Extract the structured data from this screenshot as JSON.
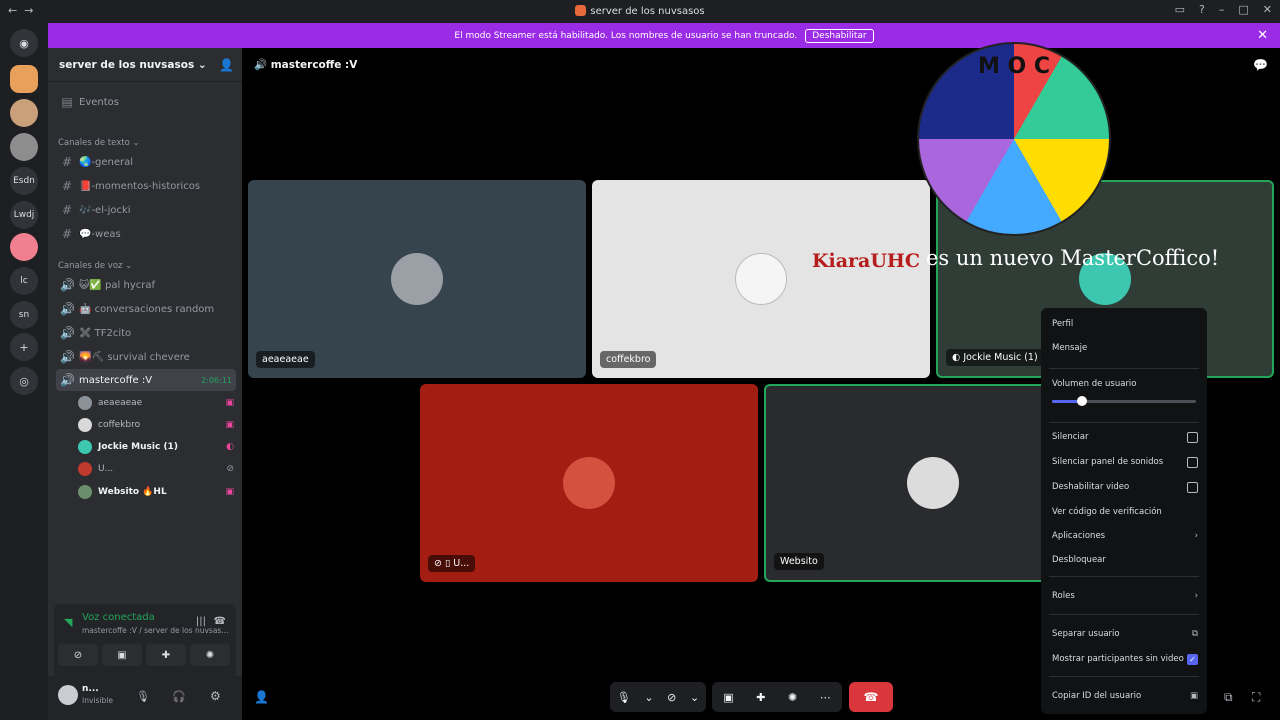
{
  "window": {
    "title": "server de los nuvsasos",
    "nav_back": "←",
    "nav_fwd": "→"
  },
  "banner": {
    "text": "El modo Streamer está habilitado. Los nombres de usuario se han truncado.",
    "button": "Deshabilitar",
    "close": "✕"
  },
  "guilds": [
    {
      "label": "Esdn"
    },
    {
      "label": "Lwdj"
    },
    {
      "label": "lc"
    },
    {
      "label": "sn"
    }
  ],
  "sidebar": {
    "server_name": "server de los nuvsasos",
    "events": "Eventos",
    "text_category": "Canales de texto",
    "text_channels": [
      "🌏-general",
      "📕-momentos-historicos",
      "🎶-el-jocki",
      "💬-weas"
    ],
    "voice_category": "Canales de voz",
    "voice_channels": [
      "😺✅ pal hycraf",
      "🤖 conversaciones random",
      "✖️ TF2cito",
      "🌄⛏ survival chevere"
    ],
    "active_voice": {
      "name": "mastercoffe :V",
      "timer": "2:06:11"
    },
    "members": [
      {
        "name": "aeaeaeae",
        "bold": false
      },
      {
        "name": "coffekbro",
        "bold": false
      },
      {
        "name": "Jockie Music (1)",
        "bold": true
      },
      {
        "name": "U...",
        "bold": false
      },
      {
        "name": "Websito 🔥HL",
        "bold": true
      }
    ]
  },
  "voice_panel": {
    "title": "Voz conectada",
    "subtitle": "mastercoffe :V / server de los nuvsas..."
  },
  "user": {
    "name": "n...",
    "status": "Invisible"
  },
  "stage": {
    "channel_title": "mastercoffe :V",
    "tiles": [
      {
        "label": "aeaeaeae"
      },
      {
        "label": "coffekbro"
      },
      {
        "label": "Jockie Music (1)"
      },
      {
        "label": "U..."
      },
      {
        "label": "Websito"
      }
    ],
    "overlay_text": "es un nuevo MasterCoffico!",
    "overlay_brand": "KiaraUHC",
    "wheel_letters": "M O C"
  },
  "context_menu": {
    "items": [
      {
        "label": "Perfil"
      },
      {
        "label": "Mensaje"
      },
      {
        "label": "Volumen de usuario"
      },
      {
        "label": "Silenciar"
      },
      {
        "label": "Silenciar panel de sonidos"
      },
      {
        "label": "Deshabilitar video"
      },
      {
        "label": "Ver código de verificación"
      },
      {
        "label": "Aplicaciones"
      },
      {
        "label": "Desbloquear"
      },
      {
        "label": "Roles"
      },
      {
        "label": "Separar usuario"
      },
      {
        "label": "Mostrar participantes sin video"
      },
      {
        "label": "Copiar ID del usuario"
      }
    ],
    "volume_fraction": 0.21,
    "show_no_video_checked": true
  },
  "colors": {
    "banner": "#9b2ce6",
    "tile1": "#36444d",
    "tile2": "#e4e4e4",
    "tile3": "#2f3d36",
    "tile4": "#a31d12",
    "tile5": "#2a2b2e",
    "accent": "#5865f2",
    "hangup": "#da373c",
    "connected": "#23a55a"
  }
}
